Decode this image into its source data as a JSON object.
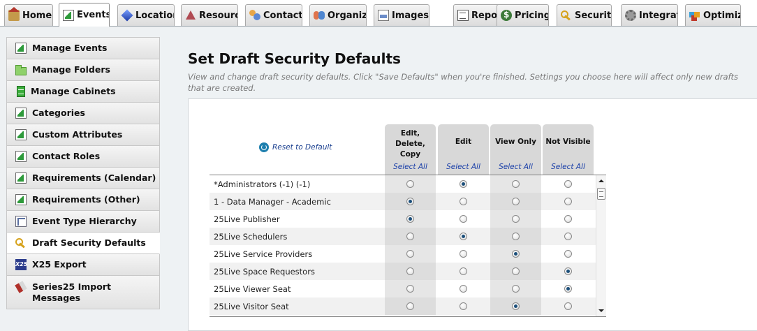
{
  "tabs": [
    {
      "label": "Home",
      "icon": "house-icon",
      "active": false
    },
    {
      "label": "Events",
      "icon": "document-icon",
      "active": true
    },
    {
      "label": "Locations",
      "icon": "cube-icon",
      "active": false
    },
    {
      "label": "Resources",
      "icon": "pyramid-icon",
      "active": false
    },
    {
      "label": "Contacts",
      "icon": "contacts-icon",
      "active": false
    },
    {
      "label": "Organizations",
      "icon": "organizations-icon",
      "active": false
    },
    {
      "label": "Images",
      "icon": "image-icon",
      "active": false
    },
    {
      "label": "Reports",
      "icon": "report-icon",
      "active": false
    },
    {
      "label": "Pricing",
      "icon": "dollar-icon",
      "active": false
    },
    {
      "label": "Security",
      "icon": "key-icon",
      "active": false
    },
    {
      "label": "Integration",
      "icon": "gear-icon",
      "active": false
    },
    {
      "label": "Optimizer",
      "icon": "cubes-icon",
      "active": false
    }
  ],
  "sidebar": {
    "items": [
      {
        "label": "Manage Events",
        "icon": "document-icon",
        "active": false
      },
      {
        "label": "Manage Folders",
        "icon": "folder-icon",
        "active": false
      },
      {
        "label": "Manage Cabinets",
        "icon": "cabinet-icon",
        "active": false
      },
      {
        "label": "Categories",
        "icon": "document-icon",
        "active": false
      },
      {
        "label": "Custom Attributes",
        "icon": "document-icon",
        "active": false
      },
      {
        "label": "Contact Roles",
        "icon": "document-icon",
        "active": false
      },
      {
        "label": "Requirements (Calendar)",
        "icon": "document-icon",
        "active": false
      },
      {
        "label": "Requirements (Other)",
        "icon": "document-icon",
        "active": false
      },
      {
        "label": "Event Type Hierarchy",
        "icon": "hierarchy-icon",
        "active": false
      },
      {
        "label": "Draft Security Defaults",
        "icon": "key-icon",
        "active": true
      },
      {
        "label": "X25 Export",
        "icon": "x25-icon",
        "active": false
      },
      {
        "label": "Series25 Import Messages",
        "icon": "books-icon",
        "active": false
      }
    ]
  },
  "main": {
    "title": "Set Draft Security Defaults",
    "description": "View and change draft security defaults. Click \"Save Defaults\" when you're finished. Settings you choose here will affect only new drafts that are created.",
    "reset_label": "Reset to Default",
    "icon_x25": "X25",
    "columns": [
      {
        "title_lines": [
          "Edit,",
          "Delete,",
          "Copy"
        ],
        "select_all": "Select All"
      },
      {
        "title_lines": [
          "Edit"
        ],
        "select_all": "Select All"
      },
      {
        "title_lines": [
          "View Only"
        ],
        "select_all": "Select All"
      },
      {
        "title_lines": [
          "Not Visible"
        ],
        "select_all": "Select All"
      }
    ],
    "rows": [
      {
        "name": "*Administrators (-1) (-1)",
        "selected": 1
      },
      {
        "name": "1 - Data Manager - Academic",
        "selected": 0
      },
      {
        "name": "25Live Publisher",
        "selected": 0
      },
      {
        "name": "25Live Schedulers",
        "selected": 1
      },
      {
        "name": "25Live Service Providers",
        "selected": 2
      },
      {
        "name": "25Live Space Requestors",
        "selected": 3
      },
      {
        "name": "25Live Viewer Seat",
        "selected": 3
      },
      {
        "name": "25Live Visitor Seat",
        "selected": 2
      }
    ]
  }
}
